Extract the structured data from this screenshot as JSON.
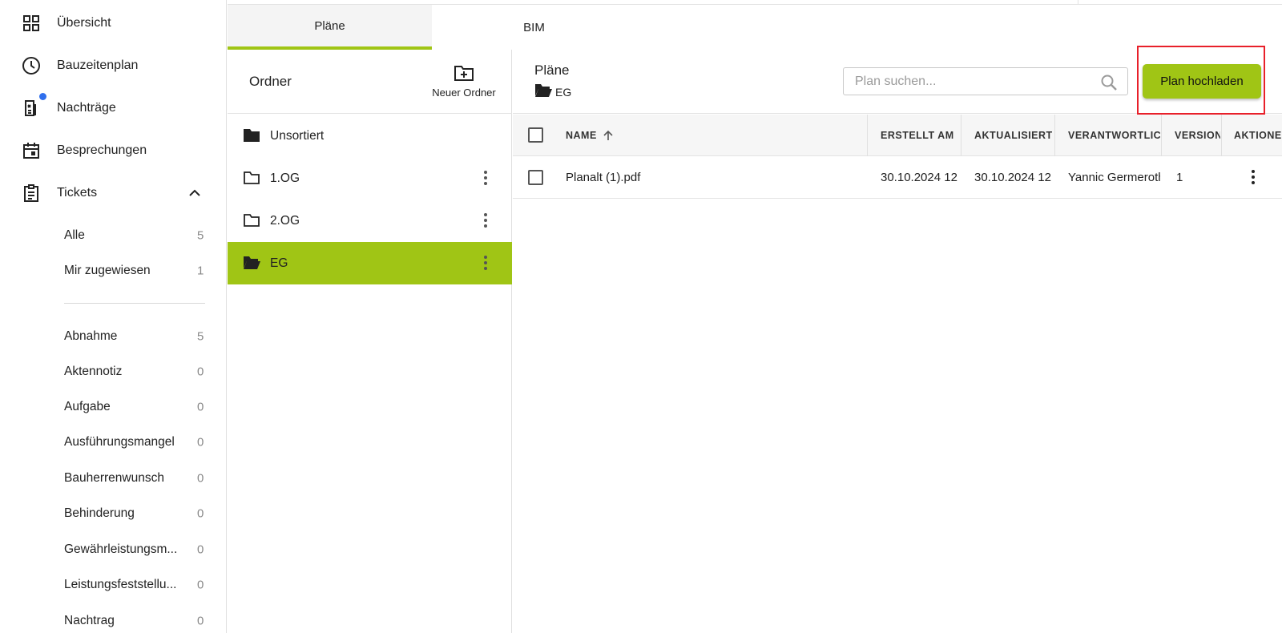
{
  "sidebar": {
    "nav": [
      {
        "label": "Übersicht",
        "icon": "dashboard-icon"
      },
      {
        "label": "Bauzeitenplan",
        "icon": "clock-icon"
      },
      {
        "label": "Nachträge",
        "icon": "document-badge-icon"
      },
      {
        "label": "Besprechungen",
        "icon": "calendar-icon"
      },
      {
        "label": "Tickets",
        "icon": "clipboard-icon"
      }
    ],
    "tickets_main": [
      {
        "label": "Alle",
        "count": "5"
      },
      {
        "label": "Mir zugewiesen",
        "count": "1"
      }
    ],
    "tickets_types": [
      {
        "label": "Abnahme",
        "count": "5"
      },
      {
        "label": "Aktennotiz",
        "count": "0"
      },
      {
        "label": "Aufgabe",
        "count": "0"
      },
      {
        "label": "Ausführungsmangel",
        "count": "0"
      },
      {
        "label": "Bauherrenwunsch",
        "count": "0"
      },
      {
        "label": "Behinderung",
        "count": "0"
      },
      {
        "label": "Gewährleistungsm...",
        "count": "0"
      },
      {
        "label": "Leistungsfeststellu...",
        "count": "0"
      },
      {
        "label": "Nachtrag",
        "count": "0"
      }
    ]
  },
  "tabs": {
    "plans": "Pläne",
    "bim": "BIM"
  },
  "folders": {
    "title": "Ordner",
    "new_folder": "Neuer Ordner",
    "items": [
      {
        "label": "Unsortiert"
      },
      {
        "label": "1.OG"
      },
      {
        "label": "2.OG"
      },
      {
        "label": "EG",
        "active": true
      }
    ]
  },
  "main": {
    "title": "Pläne",
    "breadcrumb": "EG",
    "search_placeholder": "Plan suchen...",
    "upload_label": "Plan hochladen"
  },
  "table": {
    "columns": {
      "name": "NAME",
      "created": "ERSTELLT AM",
      "updated": "AKTUALISIERT AM",
      "responsible": "VERANTWORTLICH",
      "version": "VERSION",
      "actions": "AKTIONEN"
    },
    "rows": [
      {
        "name": "Planalt (1).pdf",
        "created": "30.10.2024 12",
        "updated": "30.10.2024 12",
        "responsible": "Yannic Germeroth",
        "version": "1"
      }
    ]
  },
  "colors": {
    "accent": "#a0c515",
    "highlight": "#e8202a",
    "badge": "#2f6fed"
  }
}
